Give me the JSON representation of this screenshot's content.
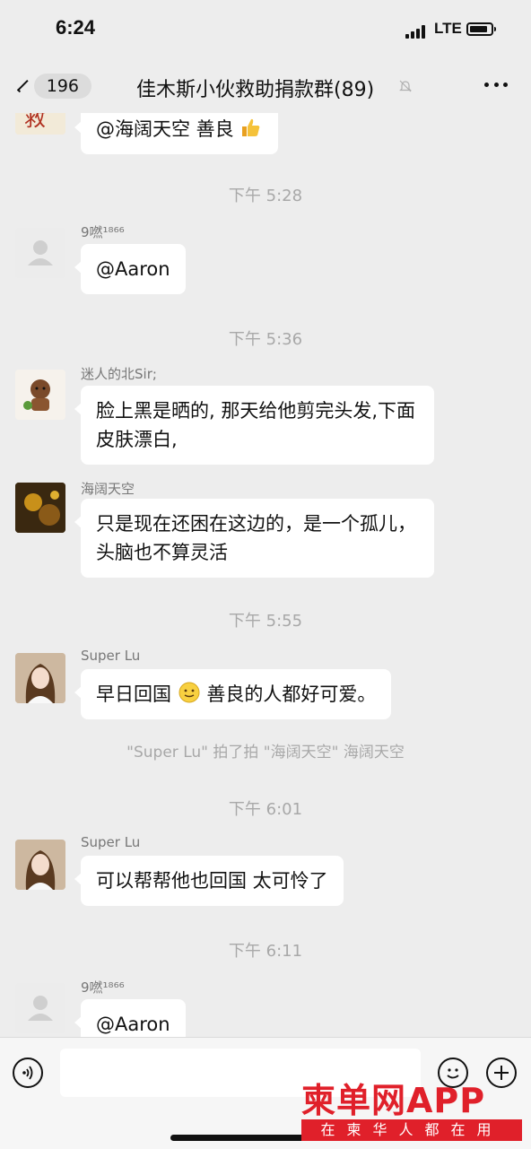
{
  "status_bar": {
    "time": "6:24",
    "network": "LTE"
  },
  "nav": {
    "back_badge": "196",
    "title": "佳木斯小伙救助捐款群(89)"
  },
  "messages": [
    {
      "text": "@海阔天空 善良"
    },
    {
      "time": "下午 5:28"
    },
    {
      "sender": "9嘫¹⁸⁶⁶",
      "text": "@Aaron"
    },
    {
      "time": "下午 5:36"
    },
    {
      "sender": "迷人的北Sir;",
      "text": "脸上黑是晒的, 那天给他剪完头发,下面皮肤漂白,"
    },
    {
      "sender": "海阔天空",
      "text": "只是现在还困在这边的，是一个孤儿，头脑也不算灵活"
    },
    {
      "time": "下午 5:55"
    },
    {
      "sender": "Super Lu",
      "text_before": "早日回国",
      "text_after": " 善良的人都好可爱。"
    },
    {
      "system": "\"Super Lu\" 拍了拍 \"海阔天空\" 海阔天空"
    },
    {
      "time": "下午 6:01"
    },
    {
      "sender": "Super Lu",
      "text": "可以帮帮他也回国 太可怜了"
    },
    {
      "time": "下午 6:11"
    },
    {
      "sender": "9嘫¹⁸⁶⁶",
      "text": "@Aaron"
    }
  ],
  "input": {
    "value": ""
  },
  "watermark": {
    "logo": "柬单网APP",
    "tagline": "在柬华人都在用"
  },
  "icons": {
    "back": "chevron-left-icon",
    "mute": "bell-slash-icon",
    "more": "ellipsis-icon",
    "voice": "voice-icon",
    "emoji": "smiley-icon",
    "plus": "plus-icon"
  },
  "colors": {
    "background": "#ededed",
    "bubble": "#ffffff",
    "watermark": "#e0202a"
  }
}
